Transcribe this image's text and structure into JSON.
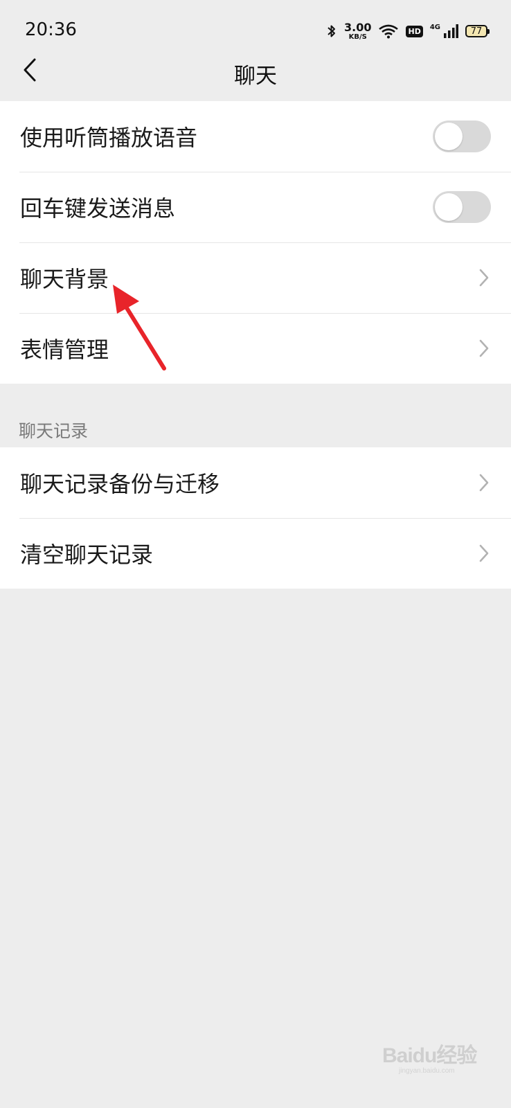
{
  "status_bar": {
    "time": "20:36",
    "speed_value": "3.00",
    "speed_unit": "KB/S",
    "hd_label": "HD",
    "network_label": "4G",
    "battery_level": "77",
    "icons": [
      "bluetooth-icon",
      "wifi-icon",
      "hd-icon",
      "signal-icon",
      "battery-icon"
    ]
  },
  "header": {
    "title": "聊天",
    "back_icon": "chevron-left-icon"
  },
  "settings_group_1": {
    "items": [
      {
        "label": "使用听筒播放语音",
        "control": "toggle",
        "state": "off"
      },
      {
        "label": "回车键发送消息",
        "control": "toggle",
        "state": "off"
      },
      {
        "label": "聊天背景",
        "control": "chevron"
      },
      {
        "label": "表情管理",
        "control": "chevron"
      }
    ]
  },
  "chat_history_section": {
    "header": "聊天记录",
    "items": [
      {
        "label": "聊天记录备份与迁移",
        "control": "chevron"
      },
      {
        "label": "清空聊天记录",
        "control": "chevron"
      }
    ]
  },
  "annotation": {
    "arrow_color": "#e8242a",
    "points_to": "聊天背景"
  },
  "watermark": {
    "text": "Baidu经验",
    "sub": "jingyan.baidu.com"
  },
  "colors": {
    "background": "#ededed",
    "card": "#ffffff",
    "toggle_off": "#d9d9d9",
    "chevron": "#b2b2b2"
  }
}
